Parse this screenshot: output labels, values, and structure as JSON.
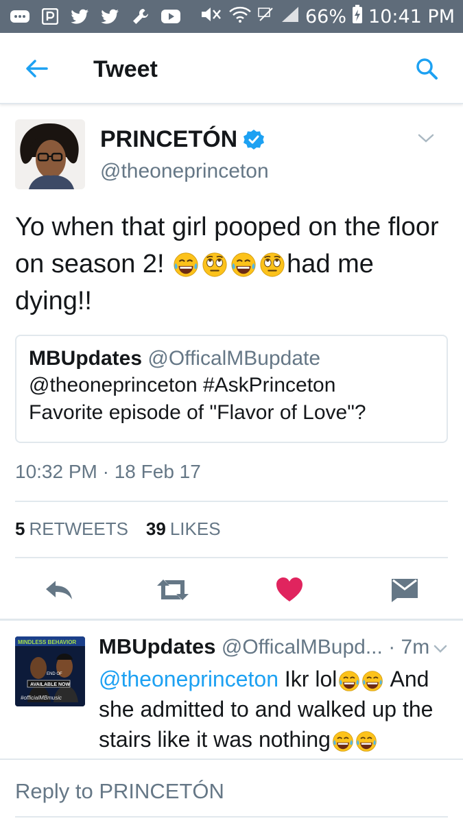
{
  "status_bar": {
    "battery": "66%",
    "time": "10:41 PM",
    "left_icons": [
      "messenger-icon",
      "pandora-icon",
      "twitter-icon",
      "twitter-icon",
      "wrench-icon",
      "youtube-icon"
    ],
    "right_icons": [
      "mute-icon",
      "wifi-icon",
      "no-signal-icon",
      "cellular-icon",
      "battery-charging-icon"
    ]
  },
  "app_bar": {
    "title": "Tweet"
  },
  "tweet": {
    "author_name": "PRINCETÓN",
    "author_handle": "@theoneprinceton",
    "verified": true,
    "text_part1": "Yo when that girl pooped on the floor on season 2!",
    "text_emojis": [
      "face-with-tears-of-joy",
      "face-with-rolling-eyes",
      "face-with-tears-of-joy",
      "face-with-rolling-eyes"
    ],
    "text_part2": "had me dying!!",
    "timestamp": "10:32 PM · 18 Feb 17",
    "retweet_count": "5",
    "retweet_label": "RETWEETS",
    "like_count": "39",
    "like_label": "LIKES",
    "quote": {
      "name": "MBUpdates",
      "handle": "@OfficalMBupdate",
      "line1": "@theoneprinceton #AskPrinceton",
      "line2": "Favorite episode of \"Flavor of Love\"?"
    }
  },
  "reply": {
    "name": "MBUpdates",
    "handle": "@OfficalMBupd...",
    "time": "· 7m",
    "mention": "@theoneprinceton",
    "text_a": "Ikr lol",
    "text_b": "And she admitted to and walked up the stairs like it was nothing",
    "avatar_text": {
      "brand": "MINDLESS BEHAVIOR",
      "available": "AVAILABLE NOW",
      "tag": "#officialMBmusic",
      "end": "END OF"
    }
  },
  "compose": {
    "placeholder": "Reply to PRINCETÓN"
  },
  "colors": {
    "status_bar": "#5f6c7a",
    "accent_blue": "#1da1f2",
    "like_red": "#e0245e",
    "secondary_text": "#657786",
    "divider": "#e1e8ed"
  }
}
